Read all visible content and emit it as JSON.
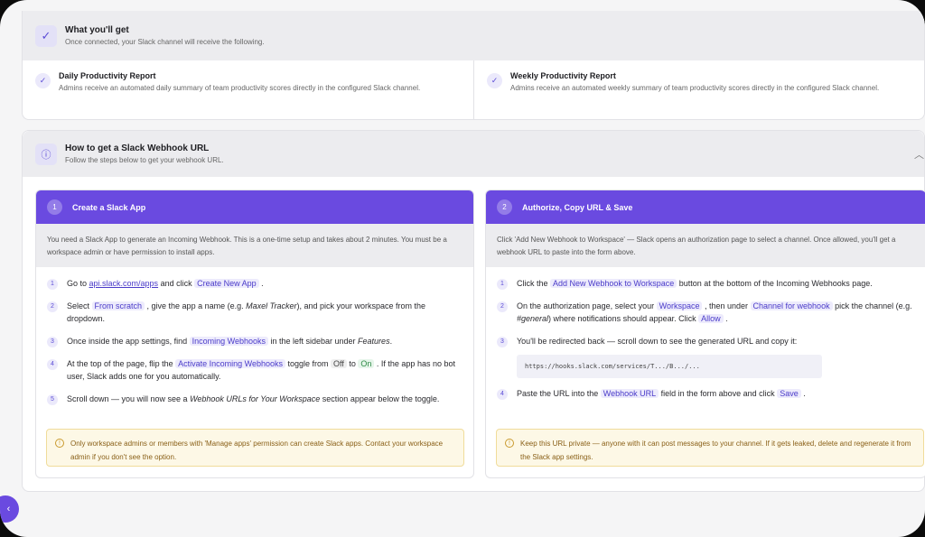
{
  "what": {
    "title": "What you'll get",
    "subtitle": "Once connected, your Slack channel will receive the following.",
    "features": [
      {
        "title": "Daily Productivity Report",
        "desc": "Admins receive an automated daily summary of team productivity scores directly in the configured Slack channel."
      },
      {
        "title": "Weekly Productivity Report",
        "desc": "Admins receive an automated weekly summary of team productivity scores directly in the configured Slack channel."
      }
    ]
  },
  "how": {
    "title": "How to get a Slack Webhook URL",
    "subtitle": "Follow the steps below to get your webhook URL."
  },
  "step1": {
    "num": "1",
    "title": "Create a Slack App",
    "intro": "You need a Slack App to generate an Incoming Webhook. This is a one-time setup and takes about 2 minutes. You must be a workspace admin or have permission to install apps.",
    "items": [
      {
        "num": "1",
        "t1": "Go to ",
        "link": "api.slack.com/apps",
        "t2": " and click ",
        "pill": "Create New App",
        "t3": " ."
      },
      {
        "num": "2",
        "t1": "Select ",
        "pill": "From scratch",
        "t2": " , give the app a name (e.g. ",
        "em": "Maxel Tracker",
        "t3": "), and pick your workspace from the dropdown."
      },
      {
        "num": "3",
        "t1": "Once inside the app settings, find ",
        "pill": "Incoming Webhooks",
        "t2": " in the left sidebar under ",
        "em": "Features",
        "t3": "."
      },
      {
        "num": "4",
        "t1": "At the top of the page, flip the ",
        "pill": "Activate Incoming Webhooks",
        "t2": " toggle from ",
        "off": "Off",
        "t3": " to ",
        "on": "On",
        "t4": " . If the app has no bot user, Slack adds one for you automatically."
      },
      {
        "num": "5",
        "t1": "Scroll down — you will now see a ",
        "em": "Webhook URLs for Your Workspace",
        "t2": " section appear below the toggle."
      }
    ],
    "warning": "Only workspace admins or members with 'Manage apps' permission can create Slack apps. Contact your workspace admin if you don't see the option."
  },
  "step2": {
    "num": "2",
    "title": "Authorize, Copy URL & Save",
    "intro": "Click 'Add New Webhook to Workspace' — Slack opens an authorization page to select a channel. Once allowed, you'll get a webhook URL to paste into the form above.",
    "items": [
      {
        "num": "1",
        "t1": "Click the ",
        "pill": "Add New Webhook to Workspace",
        "t2": " button at the bottom of the Incoming Webhooks page."
      },
      {
        "num": "2",
        "t1": "On the authorization page, select your ",
        "pill": "Workspace",
        "t2": " , then under ",
        "pill2": "Channel for webhook",
        "t3": " pick the channel (e.g. ",
        "em": "#general",
        "t4": ") where notifications should appear. Click ",
        "pill3": "Allow",
        "t5": " ."
      },
      {
        "num": "3",
        "t1": "You'll be redirected back — scroll down to see the generated URL and copy it:"
      },
      {
        "num": "4",
        "t1": "Paste the URL into the ",
        "pill": "Webhook URL",
        "t2": " field in the form above and click ",
        "pill2": "Save",
        "t3": " ."
      }
    ],
    "code": "https://hooks.slack.com/services/T.../B.../...",
    "warning": "Keep this URL private — anyone with it can post messages to your channel. If it gets leaked, delete and regenerate it from the Slack app settings."
  },
  "icons": {
    "check": "check-icon",
    "info": "info-icon",
    "chevron": "chevron-up-icon",
    "warning": "warning-icon",
    "back": "chevron-left-icon"
  },
  "colors": {
    "accent": "#6a4ae0",
    "warning_bg": "#fdf8e6",
    "warning_text": "#8a6018"
  }
}
